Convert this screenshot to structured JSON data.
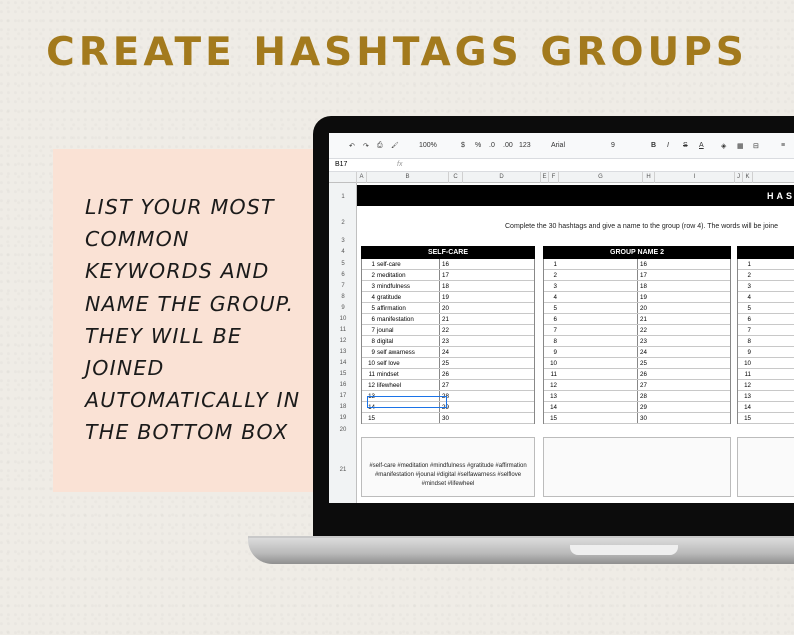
{
  "headline": "CREATE HASHTAGS GROUPS",
  "card_text": "LIST YOUR MOST\nCOMMON\nKEYWORDS AND\nNAME THE GROUP.\nTHEY WILL BE\nJOINED\nAUTOMATICALLY IN\nTHE BOTTOM BOX",
  "colors": {
    "headline": "#a37a1d",
    "card": "#fae2d5",
    "banner": "#000000",
    "selection": "#1a73e8"
  },
  "toolbar": {
    "undo": "↶",
    "redo": "↷",
    "print": "⎙",
    "paint": "🖌",
    "zoom": "100%",
    "currency": "$",
    "percent": "%",
    "dec_less": ".0",
    "dec_more": ".00",
    "format": "123",
    "font": "Arial",
    "size": "9",
    "bold": "B",
    "italic": "I",
    "strike": "S",
    "text_color": "A"
  },
  "formula_bar": {
    "cell": "B17",
    "fx": "fx"
  },
  "columns": [
    "A",
    "B",
    "C",
    "D",
    "E",
    "F",
    "G",
    "H",
    "I",
    "J",
    "K"
  ],
  "rows": [
    "1",
    "2",
    "3",
    "4",
    "5",
    "6",
    "7",
    "8",
    "9",
    "10",
    "11",
    "12",
    "13",
    "14",
    "15",
    "16",
    "17",
    "18",
    "19",
    "20",
    "21"
  ],
  "sheet": {
    "banner": "HAS",
    "instructions": "Complete the 30 hashtags and give a name to the group (row 4). The words will be joine",
    "groups": [
      {
        "title": "SELF-CARE",
        "left_nums": [
          "1",
          "2",
          "3",
          "4",
          "5",
          "6",
          "7",
          "8",
          "9",
          "10",
          "11",
          "12",
          "13",
          "14",
          "15"
        ],
        "left_words": [
          "self-care",
          "meditation",
          "mindfulness",
          "gratitude",
          "affirmation",
          "manifestation",
          "jounal",
          "digital",
          "self awarness",
          "self love",
          "mindset",
          "lifewheel",
          "",
          "",
          ""
        ],
        "right_nums": [
          "16",
          "17",
          "18",
          "19",
          "20",
          "21",
          "22",
          "23",
          "24",
          "25",
          "26",
          "27",
          "28",
          "29",
          "30"
        ],
        "output": "#self-care #meditation #mindfulness #gratitude #affirmation #manifestation #jounal #digital #selfawarness #selflove #mindset #lifewheel"
      },
      {
        "title": "GROUP NAME 2",
        "left_nums": [
          "1",
          "2",
          "3",
          "4",
          "5",
          "6",
          "7",
          "8",
          "9",
          "10",
          "11",
          "12",
          "13",
          "14",
          "15"
        ],
        "left_words": [
          "",
          "",
          "",
          "",
          "",
          "",
          "",
          "",
          "",
          "",
          "",
          "",
          "",
          "",
          ""
        ],
        "right_nums": [
          "16",
          "17",
          "18",
          "19",
          "20",
          "21",
          "22",
          "23",
          "24",
          "25",
          "26",
          "27",
          "28",
          "29",
          "30"
        ],
        "output": ""
      },
      {
        "title": "",
        "left_nums": [
          "1",
          "2",
          "3",
          "4",
          "5",
          "6",
          "7",
          "8",
          "9",
          "10",
          "11",
          "12",
          "13",
          "14",
          "15"
        ],
        "left_words": [
          "",
          "",
          "",
          "",
          "",
          "",
          "",
          "",
          "",
          "",
          "",
          "",
          "",
          "",
          ""
        ],
        "right_nums": [],
        "output": ""
      }
    ]
  }
}
